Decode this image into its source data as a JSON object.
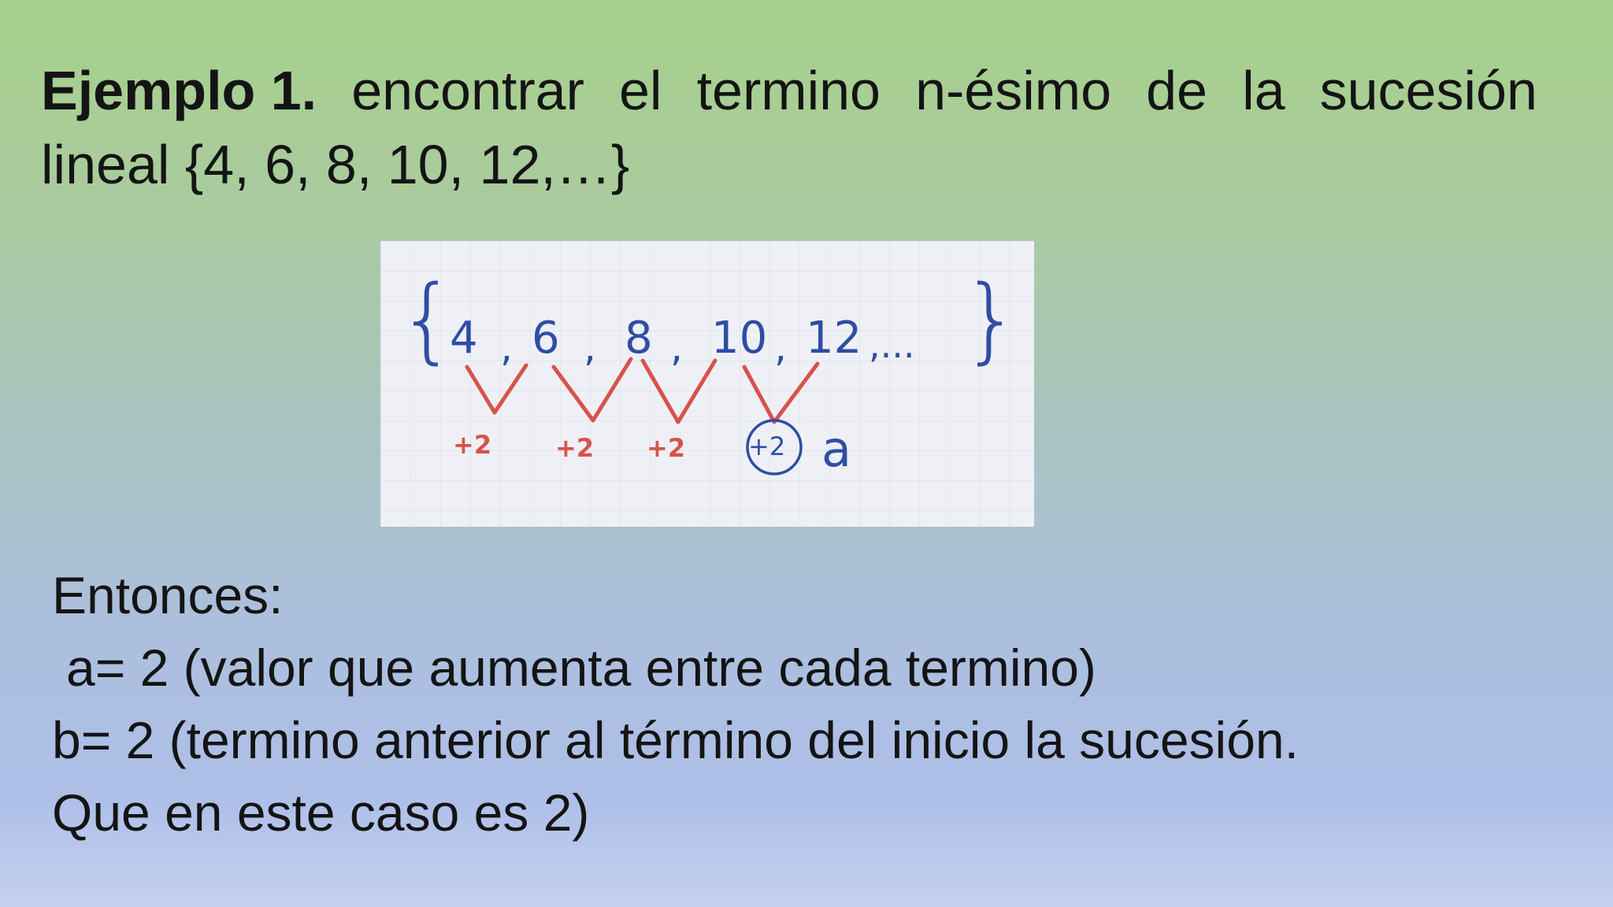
{
  "title": {
    "label": "Ejemplo 1.",
    "words": [
      "encontrar",
      "el",
      "termino",
      "n-ésimo",
      "de",
      "la",
      "sucesión"
    ],
    "line2": "lineal {4, 6, 8, 10, 12,…}"
  },
  "figure": {
    "brace_open": "{",
    "brace_close": "}",
    "terms": [
      "4",
      "6",
      "8",
      "10",
      "12"
    ],
    "comma": ",",
    "ellipsis": ",...",
    "differences": [
      "+2",
      "+2",
      "+2",
      "+2"
    ],
    "variable": "a",
    "colors": {
      "ink_blue": "#2f4da3",
      "ink_red": "#d8524a"
    }
  },
  "body": {
    "lines": [
      "Entonces:",
      "a= 2 (valor que aumenta entre cada termino)",
      "b= 2 (termino anterior al término del inicio la sucesión.",
      "Que en este caso es 2)"
    ]
  }
}
